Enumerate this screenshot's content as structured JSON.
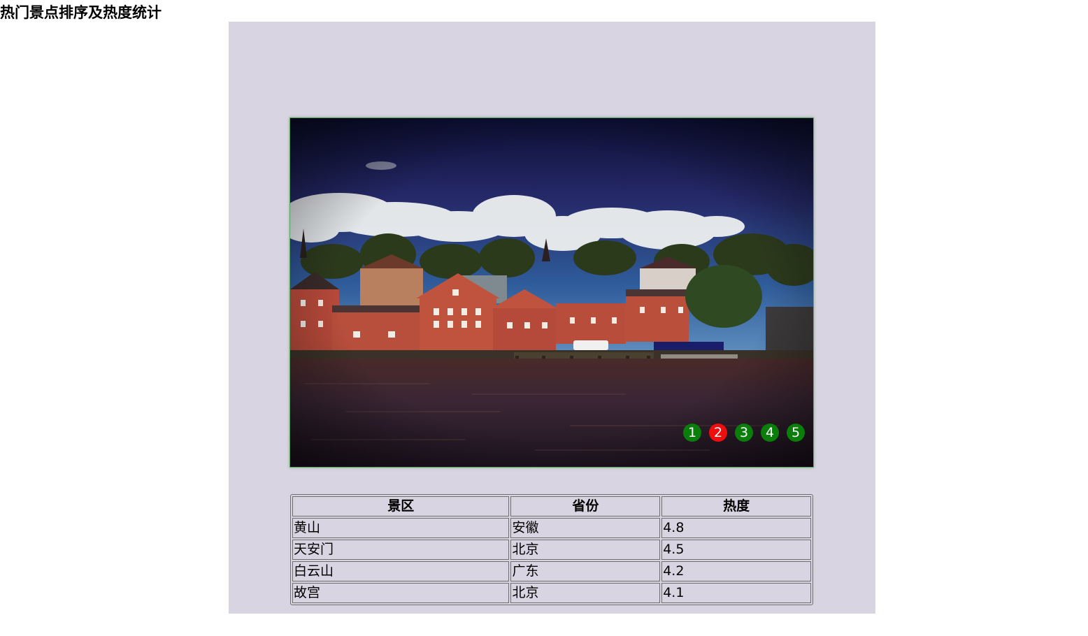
{
  "page": {
    "title": "热门景点排序及热度统计"
  },
  "carousel": {
    "active_index": 2,
    "dots": [
      "1",
      "2",
      "3",
      "4",
      "5"
    ],
    "colors": {
      "dot": "#0a7d0a",
      "dot_active": "#ee0e0e"
    }
  },
  "table": {
    "headers": [
      "景区",
      "省份",
      "热度"
    ],
    "rows": [
      [
        "黄山",
        "安徽",
        "4.8"
      ],
      [
        "天安门",
        "北京",
        "4.5"
      ],
      [
        "白云山",
        "广东",
        "4.2"
      ],
      [
        "故宫",
        "北京",
        "4.1"
      ]
    ]
  },
  "colors": {
    "panel_background": "#d9d4e1",
    "border": "#6e6e6e"
  }
}
